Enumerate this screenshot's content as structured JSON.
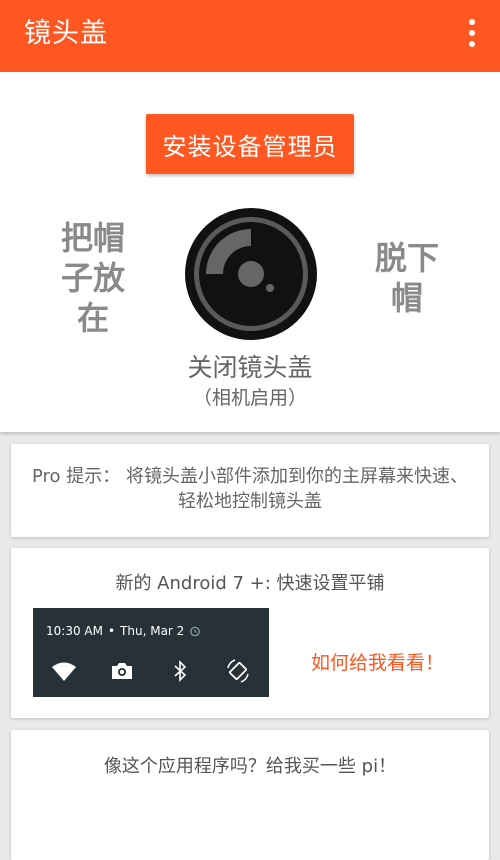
{
  "appbar": {
    "title": "镜头盖",
    "menu_icon": "more-vert-icon"
  },
  "main": {
    "install_button": "安装设备管理员",
    "left_action": "把帽子放在",
    "right_action": "脱下帽",
    "lens_status": "关闭镜头盖",
    "lens_sub": "（相机启用）",
    "lens_icon": "camera-lens-icon"
  },
  "tip": {
    "text": "Pro 提示： 将镜头盖小部件添加到你的主屏幕来快速、 轻松地控制镜头盖"
  },
  "tile": {
    "title": "新的 Android 7 +: 快速设置平铺",
    "qs_time": "10:30 AM",
    "qs_date": "Thu, Mar 2",
    "icons": [
      "wifi-icon",
      "camera-icon",
      "bluetooth-icon",
      "rotate-icon"
    ],
    "link": "如何给我看看！"
  },
  "donate": {
    "text": "像这个应用程序吗？给我买一些 pi！"
  },
  "colors": {
    "accent": "#ff5722",
    "qs_panel": "#263238",
    "text_gray": "#666666"
  }
}
